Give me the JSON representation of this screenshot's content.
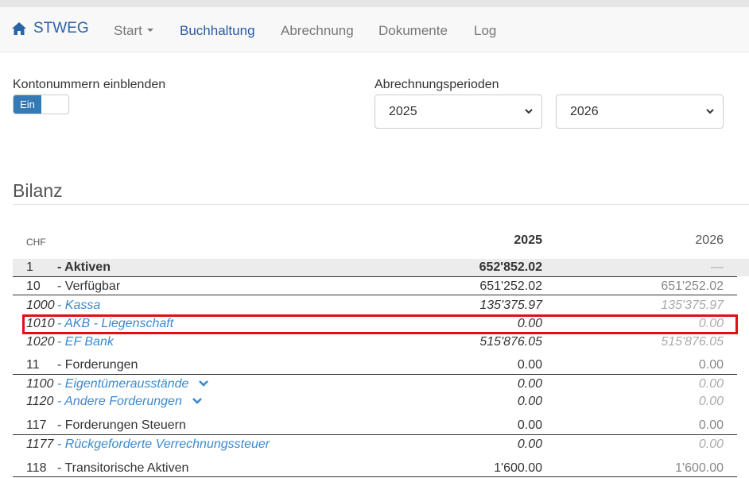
{
  "navbar": {
    "brand": "STWEG",
    "items": [
      {
        "label": "Start"
      },
      {
        "label": "Buchhaltung"
      },
      {
        "label": "Abrechnung"
      },
      {
        "label": "Dokumente"
      },
      {
        "label": "Log"
      }
    ]
  },
  "controls": {
    "account_numbers_label": "Kontonummern einblenden",
    "toggle_on_label": "Ein",
    "periods_label": "Abrechnungsperioden",
    "period_from": "2025",
    "period_to": "2026"
  },
  "section_title": "Bilanz",
  "table": {
    "currency": "CHF",
    "col1": "2025",
    "col2": "2026",
    "rows": [
      {
        "num": "1",
        "name": "- Aktiven",
        "v1": "652'852.02",
        "v2": "—"
      },
      {
        "num": "10",
        "name": "- Verfügbar",
        "v1": "651'252.02",
        "v2": "651'252.02"
      },
      {
        "num": "1000",
        "name": "- Kassa",
        "v1": "135'375.97",
        "v2": "135'375.97"
      },
      {
        "num": "1010",
        "name": "- AKB - Liegenschaft",
        "v1": "0.00",
        "v2": "0.00"
      },
      {
        "num": "1020",
        "name": "- EF Bank",
        "v1": "515'876.05",
        "v2": "515'876.05"
      },
      {
        "num": "11",
        "name": "- Forderungen",
        "v1": "0.00",
        "v2": "0.00"
      },
      {
        "num": "1100",
        "name": "- Eigentümerausstände",
        "v1": "0.00",
        "v2": "0.00"
      },
      {
        "num": "1120",
        "name": "- Andere Forderungen",
        "v1": "0.00",
        "v2": "0.00"
      },
      {
        "num": "117",
        "name": "- Forderungen Steuern",
        "v1": "0.00",
        "v2": "0.00"
      },
      {
        "num": "1177",
        "name": "- Rückgeforderte Verrechnungssteuer",
        "v1": "0.00",
        "v2": "0.00"
      },
      {
        "num": "118",
        "name": "- Transitorische Aktiven",
        "v1": "1'600.00",
        "v2": "1'600.00"
      }
    ]
  }
}
